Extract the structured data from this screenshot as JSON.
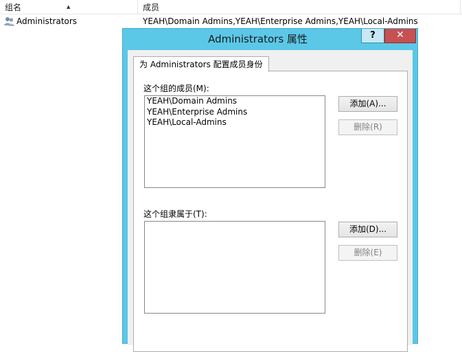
{
  "list_view": {
    "columns": {
      "name": "组名",
      "members": "成员"
    },
    "rows": [
      {
        "name": "Administrators",
        "members": "YEAH\\Domain Admins,YEAH\\Enterprise Admins,YEAH\\Local-Admins"
      }
    ]
  },
  "dialog": {
    "title": "Administrators 属性",
    "help_label": "?",
    "close_label": "✕",
    "tab_label": "为 Administrators 配置成员身份",
    "members_label": "这个组的成员(M):",
    "members": [
      "YEAH\\Domain Admins",
      "YEAH\\Enterprise Admins",
      "YEAH\\Local-Admins"
    ],
    "add_members_label": "添加(A)...",
    "remove_members_label": "删除(R)",
    "member_of_label": "这个组隶属于(T):",
    "member_of": [],
    "add_member_of_label": "添加(D)...",
    "remove_member_of_label": "删除(E)"
  },
  "colors": {
    "title_bar": "#5bc8e8",
    "close_button": "#c75050"
  }
}
